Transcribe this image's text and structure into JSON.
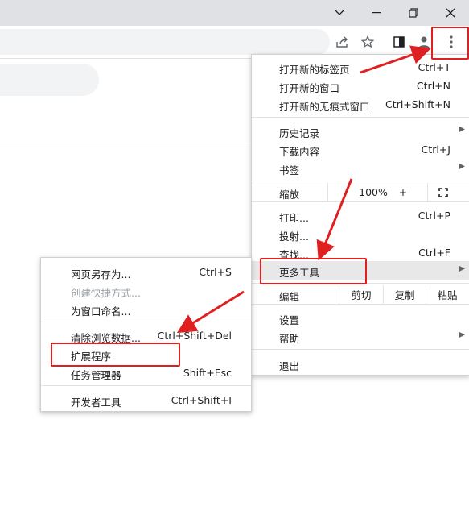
{
  "window": {
    "tabs_chevron_icon": "chevron-down-icon",
    "minimize_icon": "minimize-icon",
    "restore_icon": "restore-icon",
    "close_icon": "close-icon"
  },
  "toolbar": {
    "share_icon": "share-icon",
    "bookmark_icon": "star-icon",
    "sidepanel_icon": "side-panel-icon",
    "profile_icon": "profile-icon",
    "menu_icon": "more-vert-icon"
  },
  "menu": {
    "new_tab": {
      "label": "打开新的标签页",
      "shortcut": "Ctrl+T"
    },
    "new_window": {
      "label": "打开新的窗口",
      "shortcut": "Ctrl+N"
    },
    "new_incognito": {
      "label": "打开新的无痕式窗口",
      "shortcut": "Ctrl+Shift+N"
    },
    "history": {
      "label": "历史记录"
    },
    "downloads": {
      "label": "下载内容",
      "shortcut": "Ctrl+J"
    },
    "bookmarks": {
      "label": "书签"
    },
    "zoom": {
      "label": "缩放",
      "minus": "-",
      "value": "100%",
      "plus": "+"
    },
    "print": {
      "label": "打印...",
      "shortcut": "Ctrl+P"
    },
    "cast": {
      "label": "投射..."
    },
    "find": {
      "label": "查找...",
      "shortcut": "Ctrl+F"
    },
    "more_tools": {
      "label": "更多工具"
    },
    "edit": {
      "label": "编辑",
      "cut": "剪切",
      "copy": "复制",
      "paste": "粘贴"
    },
    "settings": {
      "label": "设置"
    },
    "help": {
      "label": "帮助"
    },
    "exit": {
      "label": "退出"
    }
  },
  "submenu": {
    "save_page": {
      "label": "网页另存为...",
      "shortcut": "Ctrl+S"
    },
    "create_shortcut": {
      "label": "创建快捷方式..."
    },
    "name_window": {
      "label": "为窗口命名..."
    },
    "clear_data": {
      "label": "清除浏览数据...",
      "shortcut": "Ctrl+Shift+Del"
    },
    "extensions": {
      "label": "扩展程序"
    },
    "task_manager": {
      "label": "任务管理器",
      "shortcut": "Shift+Esc"
    },
    "dev_tools": {
      "label": "开发者工具",
      "shortcut": "Ctrl+Shift+I"
    }
  },
  "colors": {
    "annotation": "#e02020",
    "highlight": "#e8e8e8"
  }
}
